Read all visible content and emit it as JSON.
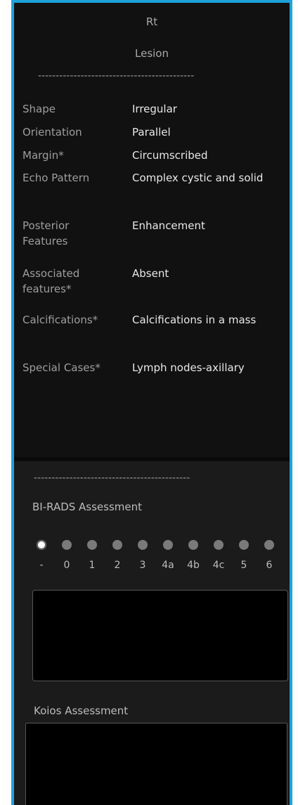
{
  "header": {
    "side": "Rt",
    "section": "Lesion"
  },
  "separator": "--------------------------------------------",
  "fields": [
    {
      "label": "Shape",
      "value": "Irregular"
    },
    {
      "label": "Orientation",
      "value": "Parallel"
    },
    {
      "label": "Margin*",
      "value": "Circumscribed"
    },
    {
      "label": "Echo Pattern",
      "value": "Complex cystic and solid"
    },
    {
      "label": "Posterior Features",
      "value": "Enhancement"
    },
    {
      "label": "Associated features*",
      "value": "Absent"
    },
    {
      "label": "Calcifications*",
      "value": "Calcifications in a mass"
    },
    {
      "label": "Special Cases*",
      "value": "Lymph nodes-axillary"
    }
  ],
  "birads": {
    "title": "BI-RADS Assessment",
    "options": [
      "-",
      "0",
      "1",
      "2",
      "3",
      "4a",
      "4b",
      "4c",
      "5",
      "6"
    ],
    "selected": "-",
    "notes": ""
  },
  "koios": {
    "title": "Koios Assessment",
    "notes": ""
  },
  "colors": {
    "border": "#1ea2dc",
    "background": "#111111"
  }
}
